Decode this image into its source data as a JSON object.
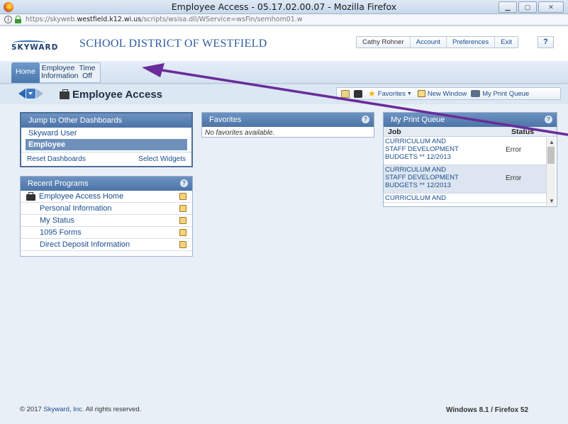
{
  "window": {
    "title": "Employee Access - 05.17.02.00.07 - Mozilla Firefox"
  },
  "browser": {
    "url_prefix": "https://skyweb.",
    "url_domain": "westfield.k12.wi.us",
    "url_path": "/scripts/wsisa.dll/WService=wsFin/semhom01.w"
  },
  "header": {
    "logo_text": "SKYWARD",
    "district": "SCHOOL DISTRICT OF WESTFIELD",
    "user": "Cathy Rohner",
    "links": [
      "Account",
      "Preferences",
      "Exit"
    ],
    "help": "?"
  },
  "tabs": [
    {
      "line1": "Home",
      "line2": ""
    },
    {
      "line1": "Employee",
      "line2": "Information"
    },
    {
      "line1": "Time",
      "line2": "Off"
    }
  ],
  "page": {
    "title": "Employee Access"
  },
  "toolbar": {
    "favorites": "Favorites",
    "new_window": "New Window",
    "print_queue": "My Print Queue"
  },
  "jump": {
    "title": "Jump to Other Dashboards",
    "items": [
      "Skyward User",
      "Employee"
    ],
    "reset": "Reset Dashboards",
    "select": "Select Widgets"
  },
  "recent": {
    "title": "Recent Programs",
    "items": [
      "Employee Access Home",
      "Personal Information",
      "My Status",
      "1095 Forms",
      "Direct Deposit Information"
    ]
  },
  "favorites": {
    "title": "Favorites",
    "empty": "No favorites available."
  },
  "print_queue": {
    "title": "My Print Queue",
    "col_job": "Job",
    "col_status": "Status",
    "rows": [
      {
        "job_l1": "CURRICULUM AND",
        "job_l2": "STAFF DEVELOPMENT",
        "job_l3": "BUDGETS ** 12/2013",
        "status": "Error"
      },
      {
        "job_l1": "CURRICULUM AND",
        "job_l2": "STAFF DEVELOPMENT",
        "job_l3": "BUDGETS ** 12/2013",
        "status": "Error"
      },
      {
        "job_l1": "CURRICULUM AND",
        "job_l2": "",
        "job_l3": "",
        "status": ""
      }
    ]
  },
  "footer": {
    "copyright_pre": "© 2017 ",
    "copyright_link": "Skyward, Inc.",
    "copyright_post": " All rights reserved.",
    "system": "Windows 8.1 / Firefox 52"
  },
  "colors": {
    "accent": "#4c74a7",
    "annotation_arrow": "#6a2c9a",
    "link": "#1a4d8f"
  }
}
